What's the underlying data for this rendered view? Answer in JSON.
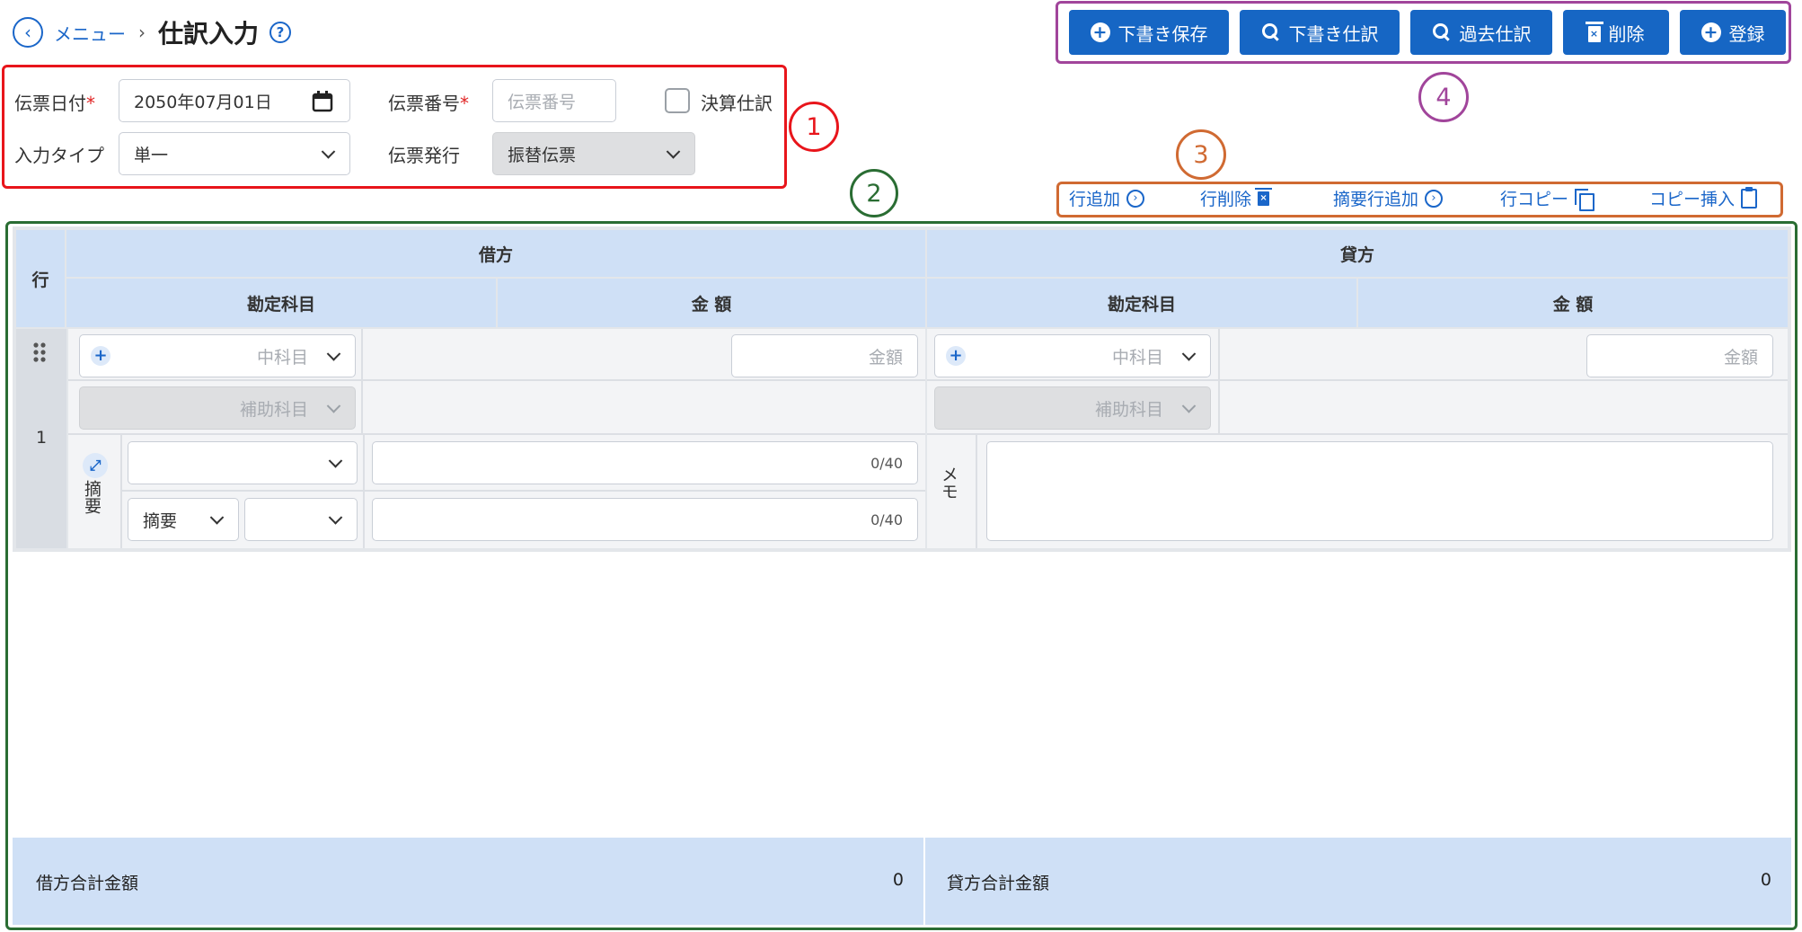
{
  "header": {
    "back_label": "メニュー",
    "separator": "›",
    "title": "仕訳入力",
    "help": "?"
  },
  "form": {
    "date_label": "伝票日付",
    "date_value": "2050年07月01日",
    "number_label": "伝票番号",
    "number_placeholder": "伝票番号",
    "closing_label": "決算仕訳",
    "input_type_label": "入力タイプ",
    "input_type_value": "単一",
    "issue_label": "伝票発行",
    "issue_value": "振替伝票",
    "required_mark": "*"
  },
  "toolbar": {
    "draft_save": "下書き保存",
    "draft_journal": "下書き仕訳",
    "past_journal": "過去仕訳",
    "delete": "削除",
    "register": "登録"
  },
  "row_actions": {
    "add_row": "行追加",
    "delete_row": "行削除",
    "add_summary_row": "摘要行追加",
    "copy_row": "行コピー",
    "copy_insert": "コピー挿入"
  },
  "table": {
    "row_header": "行",
    "debit": "借方",
    "credit": "貸方",
    "account": "勘定科目",
    "amount": "金 額",
    "middle_account_ph": "中科目",
    "sub_account_ph": "補助科目",
    "amount_ph": "金額",
    "row_number": "1",
    "summary_label": "摘要",
    "summary_select": "摘要",
    "counter1": "0/40",
    "counter2": "0/40",
    "memo_label": "メモ"
  },
  "totals": {
    "debit_label": "借方合計金額",
    "debit_value": "0",
    "credit_label": "貸方合計金額",
    "credit_value": "0"
  },
  "annotations": {
    "n1": "1",
    "n2": "2",
    "n3": "3",
    "n4": "4"
  },
  "colors": {
    "primary": "#1666c4",
    "red": "#e8151b",
    "green": "#2a6d33",
    "orange": "#d06a32",
    "purple": "#a1459b",
    "header_bg": "#cfe0f6"
  }
}
